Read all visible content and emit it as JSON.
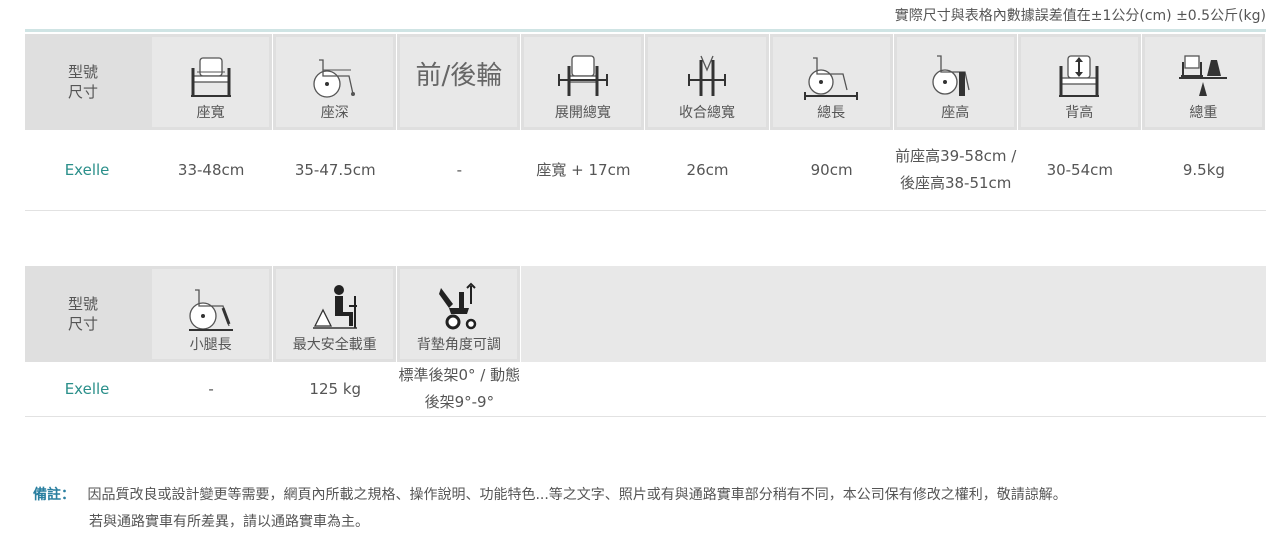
{
  "note_top": "實際尺寸與表格內數據誤差值在±1公分(cm) ±0.5公斤(kg)",
  "table1": {
    "model_header": [
      "型號",
      "尺寸"
    ],
    "headers": [
      {
        "icon": "seat-width-icon",
        "label": "座寬"
      },
      {
        "icon": "seat-depth-icon",
        "label": "座深"
      },
      {
        "icon": "",
        "label": "前/後輪",
        "big": true
      },
      {
        "icon": "open-width-icon",
        "label": "展開總寬"
      },
      {
        "icon": "folded-width-icon",
        "label": "收合總寬"
      },
      {
        "icon": "total-length-icon",
        "label": "總長"
      },
      {
        "icon": "seat-height-icon",
        "label": "座高"
      },
      {
        "icon": "back-height-icon",
        "label": "背高"
      },
      {
        "icon": "total-weight-icon",
        "label": "總重"
      }
    ],
    "row": {
      "model": "Exelle",
      "values": [
        "33-48cm",
        "35-47.5cm",
        "-",
        "座寬 + 17cm",
        "26cm",
        "90cm",
        "前座高39-58cm / 後座高38-51cm",
        "30-54cm",
        "9.5kg"
      ]
    }
  },
  "table2": {
    "model_header": [
      "型號",
      "尺寸"
    ],
    "headers": [
      {
        "icon": "leg-length-icon",
        "label": "小腿長"
      },
      {
        "icon": "max-load-icon",
        "label": "最大安全載重"
      },
      {
        "icon": "backrest-angle-icon",
        "label": "背墊角度可調"
      }
    ],
    "row": {
      "model": "Exelle",
      "values": [
        "-",
        "125 kg",
        "標準後架0° / 動態後架9°-9°"
      ]
    }
  },
  "remark": {
    "key": "備註：",
    "line1": "因品質改良或設計變更等需要，網頁內所載之規格、操作說明、功能特色...等之文字、照片或有與通路實車部分稍有不同，本公司保有修改之權利，敬請諒解。",
    "line2": "若與通路實車有所差異，請以通路實車為主。"
  }
}
